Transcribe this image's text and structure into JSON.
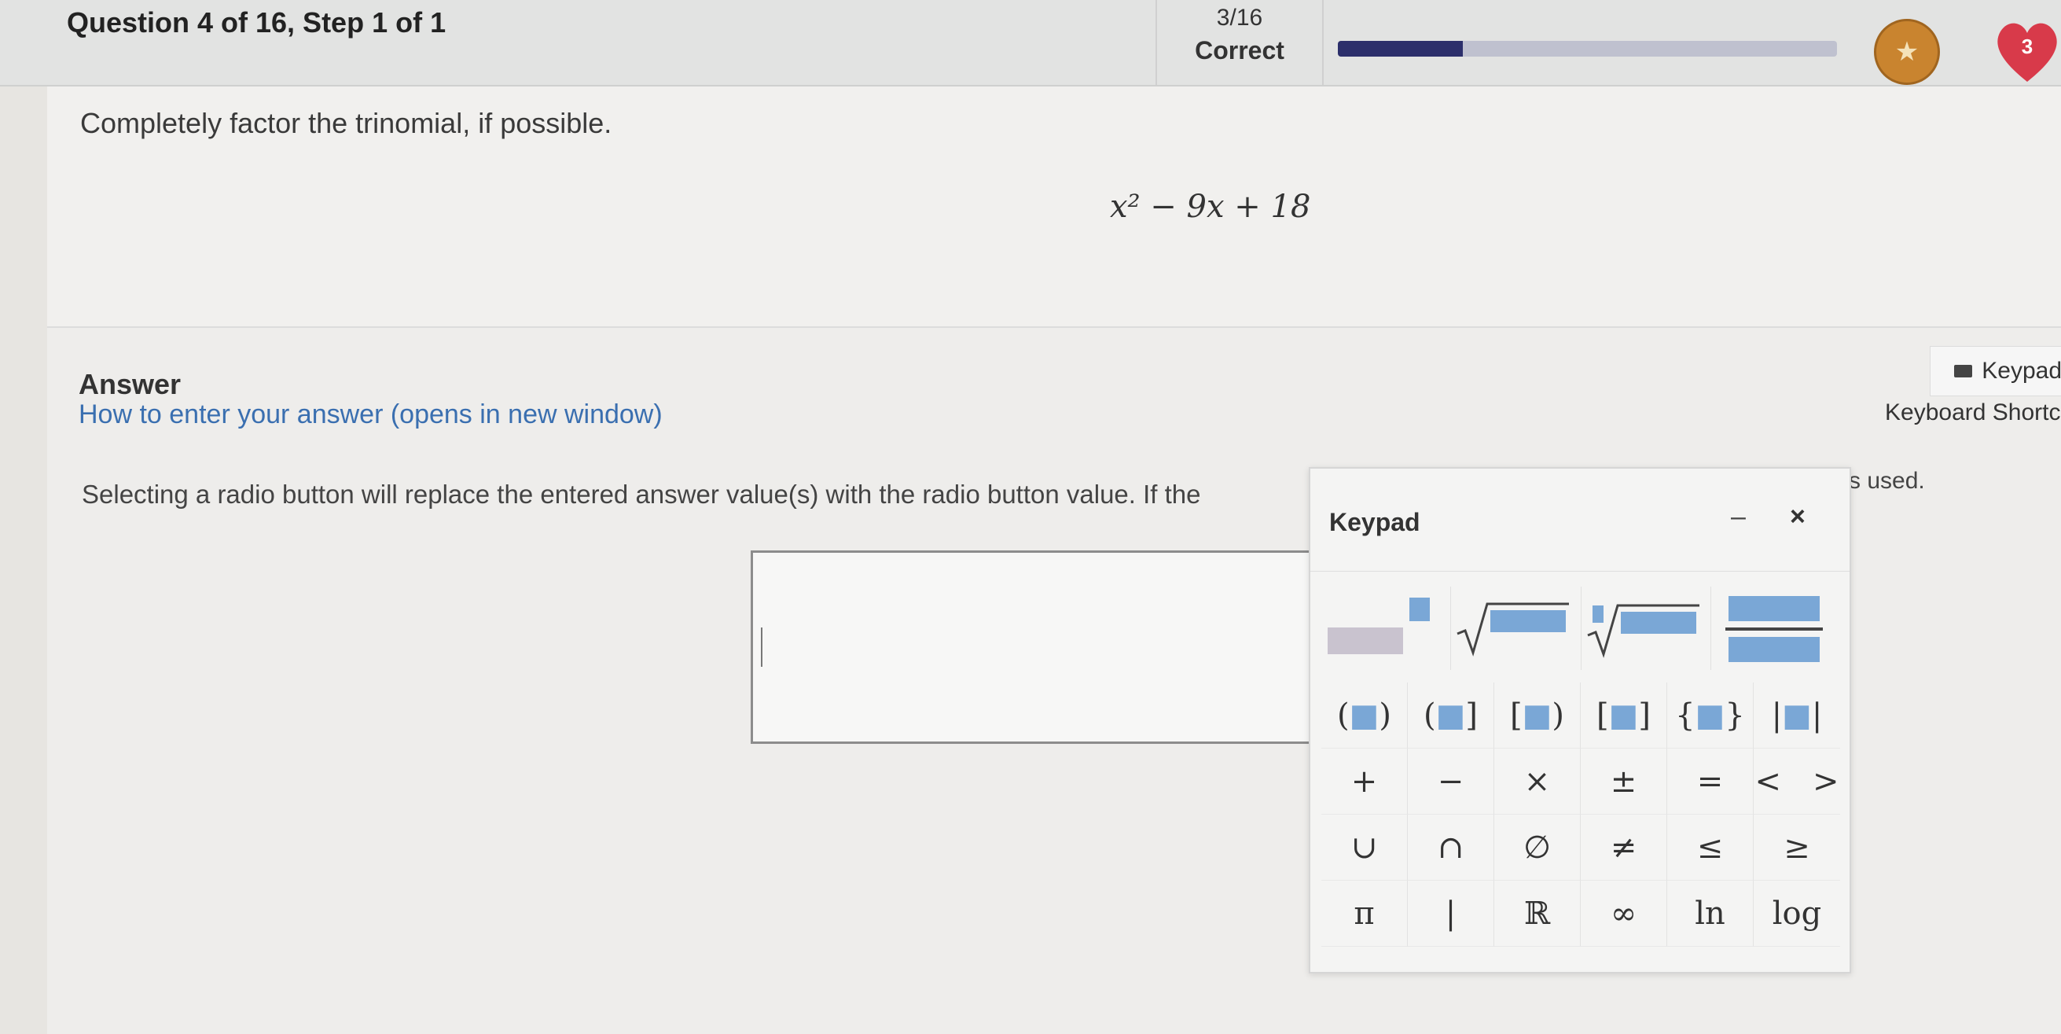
{
  "header": {
    "title": "Question 4 of 16, Step 1 of 1",
    "score_fraction": "3/16",
    "score_status": "Correct",
    "progress": 0.25,
    "progress_color": "#2c2f6b",
    "avatar_icon": "trophy-icon",
    "hearts": "3",
    "heart_color": "#d83a4a"
  },
  "question": {
    "prompt": "Completely factor the trinomial, if possible.",
    "expression": "x² − 9x + 18"
  },
  "answer": {
    "label": "Answer",
    "howto": "How to enter your answer (opens in new window)",
    "keypad_button": "Keypad",
    "shortcuts": "Keyboard Shortc",
    "instruction": "Selecting a radio button will replace the entered answer value(s) with the radio button value. If the",
    "instruction_tail": "s used.",
    "input_value": ""
  },
  "keypad": {
    "title": "Keypad",
    "minimize": "–",
    "close": "×",
    "templates": [
      "superscript",
      "square-root",
      "nth-root",
      "fraction"
    ],
    "rows": [
      [
        "(■)",
        "(■]",
        "[■)",
        "[■]",
        "{■}",
        "|■|"
      ],
      [
        "+",
        "−",
        "×",
        "±",
        "=",
        "<",
        ">"
      ],
      [
        "∪",
        "∩",
        "∅",
        "≠",
        "≤",
        "≥"
      ],
      [
        "π",
        "|",
        "ℝ",
        "∞",
        "ln",
        "log"
      ]
    ]
  }
}
